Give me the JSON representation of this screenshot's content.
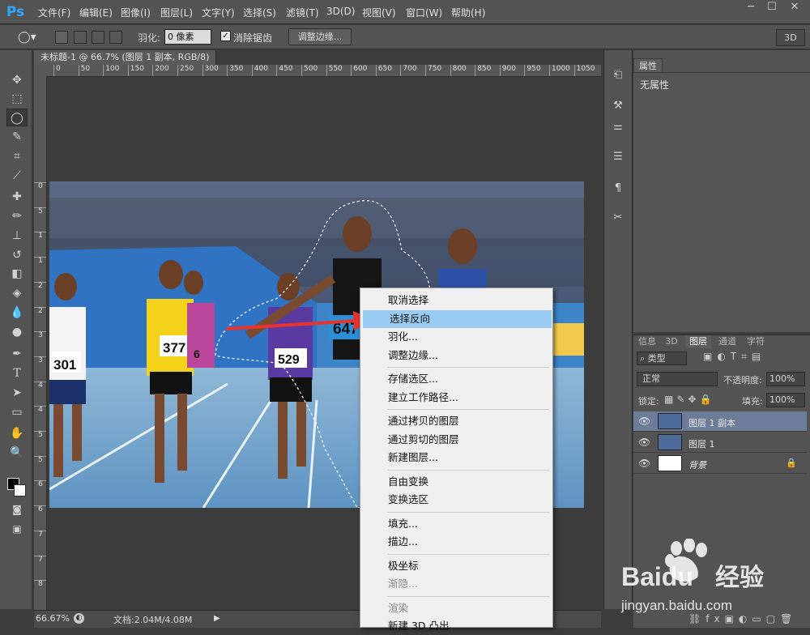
{
  "app": {
    "logo": "Ps"
  },
  "menubar": {
    "items": [
      "文件(F)",
      "编辑(E)",
      "图像(I)",
      "图层(L)",
      "文字(Y)",
      "选择(S)",
      "滤镜(T)",
      "3D(D)",
      "视图(V)",
      "窗口(W)",
      "帮助(H)"
    ]
  },
  "options": {
    "feather_label": "羽化:",
    "feather_value": "0 像素",
    "antialias_label": "消除锯齿",
    "antialias_checked": true,
    "refine_edge": "调整边缘...",
    "mode_3d": "3D"
  },
  "document": {
    "tab_title": "未标题-1 @ 66.7% (图层 1 副本, RGB/8) *"
  },
  "ruler": {
    "h_ticks": [
      "0",
      "50",
      "100",
      "150",
      "200",
      "250",
      "300",
      "350",
      "400",
      "450",
      "500",
      "550",
      "600",
      "650",
      "700",
      "750",
      "800",
      "850",
      "900",
      "950",
      "1000",
      "1050"
    ],
    "v_ticks": [
      "0",
      "5",
      "1",
      "1",
      "2",
      "2",
      "3",
      "3",
      "4",
      "4",
      "5",
      "5",
      "6",
      "6",
      "7",
      "7",
      "8"
    ]
  },
  "canvas": {
    "bibs": [
      "301",
      "377",
      "6",
      "529",
      "647"
    ]
  },
  "status": {
    "zoom": "66.67%",
    "doc_size": "文档:2.04M/4.08M"
  },
  "properties": {
    "tab": "属性",
    "empty": "无属性"
  },
  "layers_panel": {
    "tabs": [
      "信息",
      "3D",
      "图层",
      "通道",
      "字符"
    ],
    "active_tab": "图层",
    "filter": "类型",
    "blend_mode": "正常",
    "opacity_label": "不透明度:",
    "opacity": "100%",
    "lock_label": "锁定:",
    "fill_label": "填充:",
    "fill": "100%",
    "layers": [
      {
        "name": "图层 1 副本",
        "selected": true
      },
      {
        "name": "图层 1",
        "selected": false
      },
      {
        "name": "背景",
        "selected": false,
        "locked": true
      }
    ]
  },
  "context_menu": {
    "groups": [
      [
        {
          "label": "取消选择"
        },
        {
          "label": "选择反向",
          "highlighted": true
        },
        {
          "label": "羽化..."
        },
        {
          "label": "调整边缘..."
        }
      ],
      [
        {
          "label": "存储选区..."
        },
        {
          "label": "建立工作路径..."
        }
      ],
      [
        {
          "label": "通过拷贝的图层"
        },
        {
          "label": "通过剪切的图层"
        },
        {
          "label": "新建图层..."
        }
      ],
      [
        {
          "label": "自由变换"
        },
        {
          "label": "变换选区"
        }
      ],
      [
        {
          "label": "填充..."
        },
        {
          "label": "描边..."
        }
      ],
      [
        {
          "label": "极坐标"
        },
        {
          "label": "渐隐...",
          "disabled": true
        }
      ],
      [
        {
          "label": "渲染",
          "disabled": true
        },
        {
          "label": "新建 3D 凸出"
        }
      ]
    ]
  },
  "watermark": {
    "brand": "Baidu",
    "jingyan": "经验",
    "url": "jingyan.baidu.com"
  },
  "colors": {
    "accent": "#31a8ff",
    "highlight": "#99ccf2",
    "arrow": "#e8332f"
  }
}
